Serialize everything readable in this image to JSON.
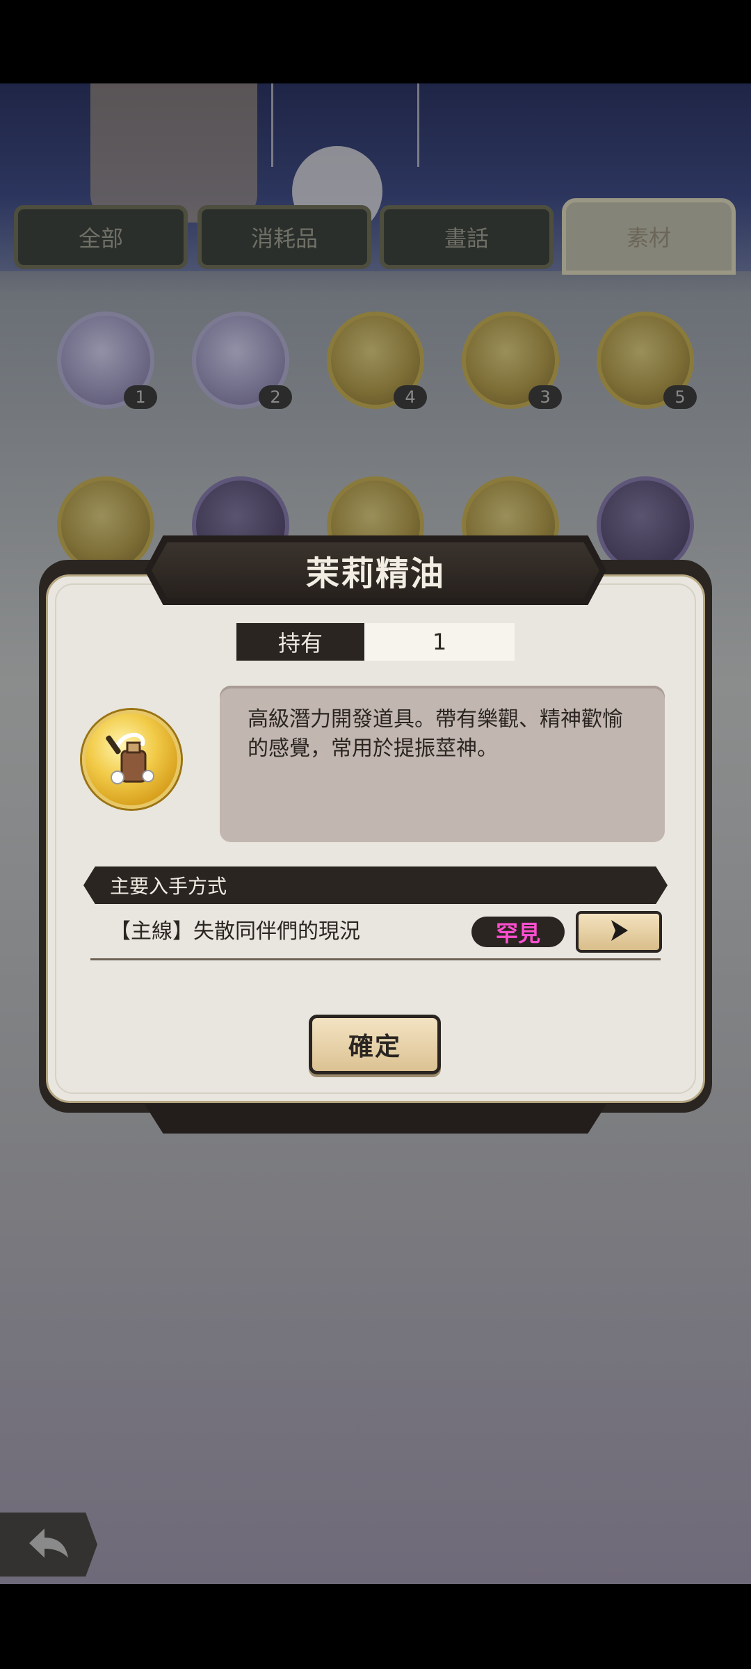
{
  "tabs": [
    {
      "label": "全部",
      "active": false
    },
    {
      "label": "消耗品",
      "active": false
    },
    {
      "label": "畫話",
      "active": false
    },
    {
      "label": "素材",
      "active": true
    }
  ],
  "inventory_counts": [
    "1",
    "2",
    "4",
    "3",
    "5"
  ],
  "dialog": {
    "title": "茉莉精油",
    "own_label": "持有",
    "own_value": "1",
    "icon": "jasmine-oil-bottle-icon",
    "description": "高級潛力開發道具。帶有樂觀、精神歡愉的感覺，常用於提振莖神。",
    "source_header": "主要入手方式",
    "source_entry": "【主線】失散同伴們的現況",
    "rarity": "罕見",
    "rarity_color": "#ff4fd0",
    "go_icon": "arrow-right-icon",
    "confirm_label": "確定"
  },
  "back_icon": "back-arrow-icon"
}
